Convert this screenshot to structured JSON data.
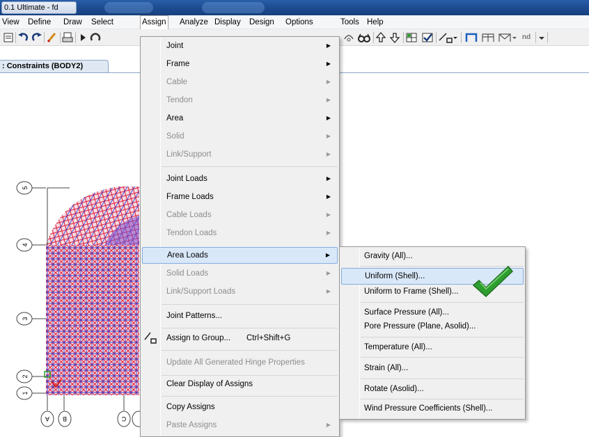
{
  "window": {
    "title": "0.1 Ultimate  - fd"
  },
  "menubar": [
    {
      "label": "View",
      "active": false
    },
    {
      "label": "Define",
      "active": false
    },
    {
      "label": "Draw",
      "active": false
    },
    {
      "label": "Select",
      "active": false
    },
    {
      "label": "Assign",
      "active": true
    },
    {
      "label": "Analyze",
      "active": false
    },
    {
      "label": "Display",
      "active": false
    },
    {
      "label": "Design",
      "active": false
    },
    {
      "label": "Options",
      "active": false
    },
    {
      "label": "Tools",
      "active": false
    },
    {
      "label": "Help",
      "active": false
    }
  ],
  "toolbar": {
    "icons": [
      "print-setup-icon",
      "undo-icon",
      "redo-icon",
      "pencil-icon",
      "print-icon",
      "run-icon",
      "refresh-icon",
      "rubber-band-icon",
      "glasses-icon",
      "arrow-up-icon",
      "arrow-down-icon",
      "grid-icon",
      "check-box-icon",
      "assign-group-icon",
      "frame-icon",
      "truss-icon",
      "truss-dropdown-icon",
      "node-icon",
      "dropdown-icon"
    ],
    "nd_label": "nd"
  },
  "tab": {
    "label": ": Constraints (BODY2)"
  },
  "grid": {
    "row_labels": [
      "5",
      "4",
      "3",
      "2",
      "1"
    ],
    "col_labels": [
      "A",
      "B",
      "C"
    ]
  },
  "assign_menu": {
    "items": [
      {
        "label": "Joint",
        "disabled": false,
        "submenu": true
      },
      {
        "label": "Frame",
        "disabled": false,
        "submenu": true
      },
      {
        "label": "Cable",
        "disabled": true,
        "submenu": true
      },
      {
        "label": "Tendon",
        "disabled": true,
        "submenu": true
      },
      {
        "label": "Area",
        "disabled": false,
        "submenu": true
      },
      {
        "label": "Solid",
        "disabled": true,
        "submenu": true
      },
      {
        "label": "Link/Support",
        "disabled": true,
        "submenu": true
      },
      {
        "label": "Joint Loads",
        "disabled": false,
        "submenu": true
      },
      {
        "label": "Frame Loads",
        "disabled": false,
        "submenu": true
      },
      {
        "label": "Cable Loads",
        "disabled": true,
        "submenu": true
      },
      {
        "label": "Tendon Loads",
        "disabled": true,
        "submenu": true
      },
      {
        "label": "Area Loads",
        "disabled": false,
        "submenu": true,
        "highlighted": true
      },
      {
        "label": "Solid Loads",
        "disabled": true,
        "submenu": true
      },
      {
        "label": "Link/Support Loads",
        "disabled": true,
        "submenu": true
      },
      {
        "label": "Joint Patterns...",
        "disabled": false,
        "submenu": false
      },
      {
        "label": "Assign to Group...",
        "disabled": false,
        "submenu": false,
        "shortcut": "Ctrl+Shift+G",
        "icon": "assign-group-icon"
      },
      {
        "label": "Update All Generated Hinge Properties",
        "disabled": true,
        "submenu": false
      },
      {
        "label": "Clear Display of Assigns",
        "disabled": false,
        "submenu": false
      },
      {
        "label": "Copy Assigns",
        "disabled": false,
        "submenu": false
      },
      {
        "label": "Paste Assigns",
        "disabled": true,
        "submenu": true
      }
    ]
  },
  "area_loads_menu": {
    "items": [
      {
        "label": "Gravity (All)...",
        "highlighted": false
      },
      {
        "label": "Uniform (Shell)...",
        "highlighted": true
      },
      {
        "label": "Uniform to Frame (Shell)...",
        "highlighted": false
      },
      {
        "label": "Surface Pressure (All)...",
        "highlighted": false
      },
      {
        "label": "Pore Pressure (Plane, Asolid)...",
        "highlighted": false
      },
      {
        "label": "Temperature (All)...",
        "highlighted": false
      },
      {
        "label": "Strain (All)...",
        "highlighted": false
      },
      {
        "label": "Rotate (Asolid)...",
        "highlighted": false
      },
      {
        "label": "Wind Pressure Coefficients (Shell)...",
        "highlighted": false
      }
    ]
  },
  "colors": {
    "accent_check": "#2e9e2e",
    "highlight": "#d9e8f9",
    "mesh_red": "#e0203a",
    "mesh_blue": "#2c3fd6"
  }
}
